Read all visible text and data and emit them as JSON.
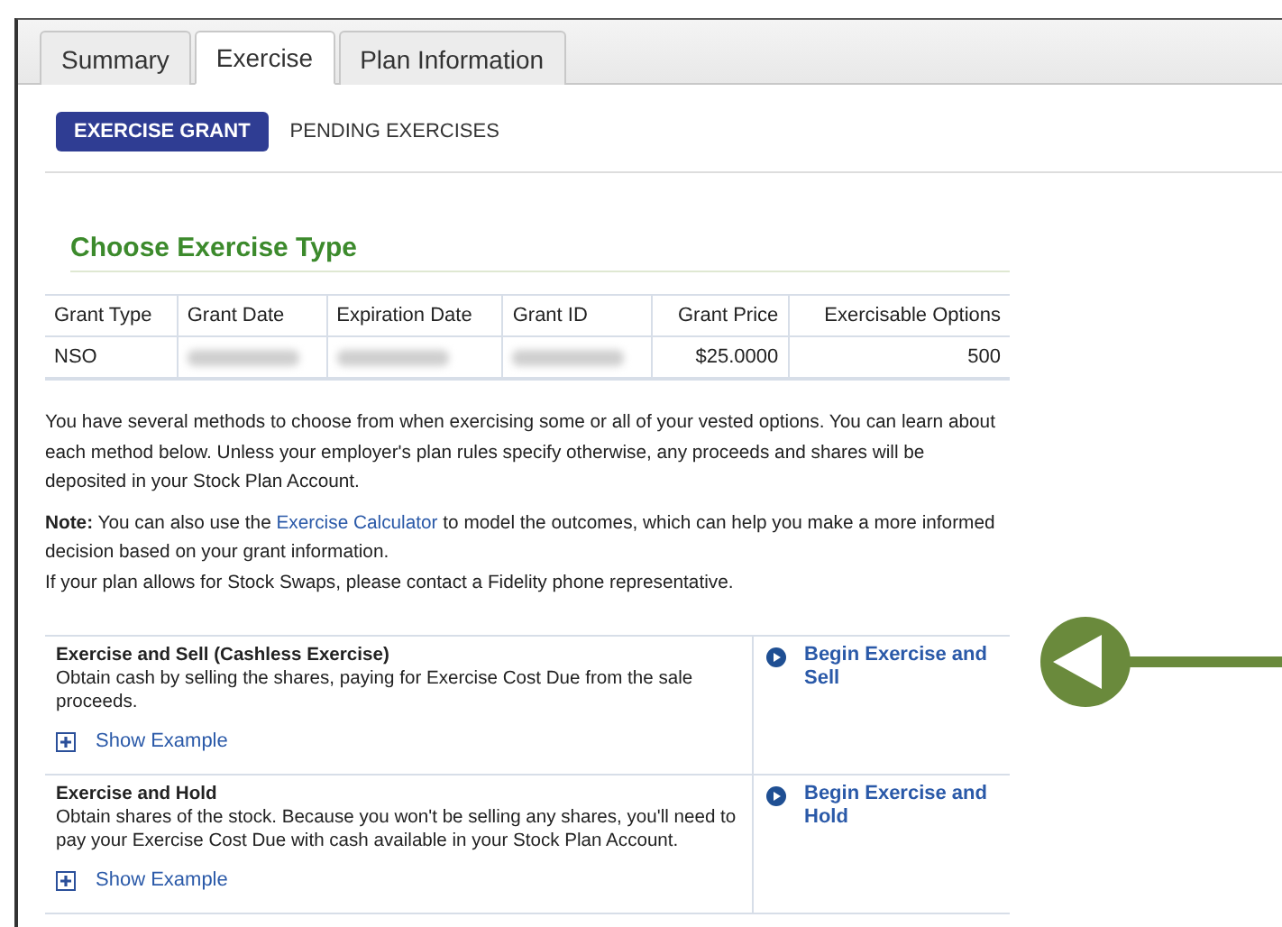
{
  "tabs": [
    {
      "label": "Summary",
      "selected": false
    },
    {
      "label": "Exercise",
      "selected": true
    },
    {
      "label": "Plan Information",
      "selected": false
    }
  ],
  "subtabs": [
    {
      "label": "EXERCISE GRANT",
      "selected": true
    },
    {
      "label": "PENDING EXERCISES",
      "selected": false
    }
  ],
  "heading": "Choose Exercise Type",
  "table": {
    "columns": [
      {
        "label": "Grant Type"
      },
      {
        "label": "Grant Date"
      },
      {
        "label": "Expiration Date"
      },
      {
        "label": "Grant ID"
      },
      {
        "label": "Grant Price"
      },
      {
        "label": "Exercisable Options"
      }
    ],
    "rows": [
      [
        {
          "text": "NSO"
        },
        {
          "kind": "redacted"
        },
        {
          "kind": "redacted"
        },
        {
          "kind": "redacted"
        },
        {
          "text": "$25.0000"
        },
        {
          "text": "500"
        }
      ]
    ]
  },
  "intro": "You have several methods to choose from when exercising some or all of your vested options. You can learn about each method below. Unless your employer's plan rules specify otherwise, any proceeds and shares will be deposited in your Stock Plan Account.",
  "note": {
    "before": "**Note:** You can also use the",
    "link": "Exercise Calculator",
    "after": "to model the outcomes, which can help you make a more informed decision based on your grant information."
  },
  "swap_note": "If your plan allows for Stock Swaps, please contact a Fidelity phone representative.",
  "methods": [
    {
      "title": "Exercise and Sell (Cashless Exercise)",
      "description": "Obtain cash by selling the shares, paying for Exercise Cost Due from the sale proceeds.",
      "example": "Show Example",
      "action": "Begin Exercise and Sell"
    },
    {
      "title": "Exercise and Hold",
      "description": "Obtain shares of the stock. Because you won't be selling any shares, you'll need to pay your Exercise Cost Due with cash available in your Stock Plan Account.",
      "example": "Show Example",
      "action": "Begin Exercise and Hold"
    }
  ],
  "annotation": {
    "kind": "arrow"
  }
}
